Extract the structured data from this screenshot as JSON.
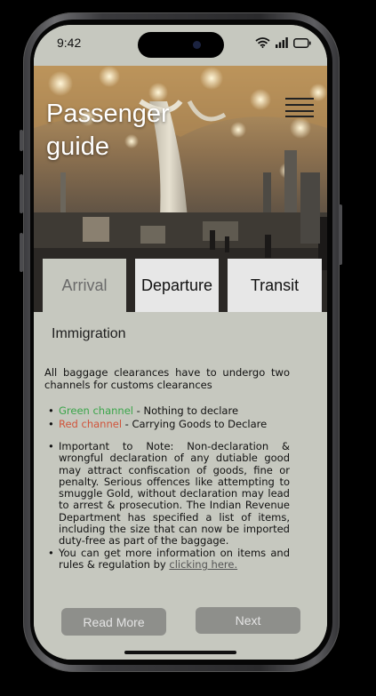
{
  "status_bar": {
    "time": "9:42"
  },
  "hero": {
    "title_line1": "Passenger",
    "title_line2": "guide"
  },
  "tabs": [
    {
      "label": "Arrival",
      "active": true
    },
    {
      "label": "Departure",
      "active": false
    },
    {
      "label": "Transit",
      "active": false
    }
  ],
  "section": {
    "title": "Immigration",
    "intro": "All baggage clearances have to undergo two channels for customs clearances",
    "channels": [
      {
        "name": "Green channel",
        "desc": " - Nothing to declare",
        "color": "#3aa54a"
      },
      {
        "name": "Red channel",
        "desc": " - Carrying Goods to Declare",
        "color": "#d0543b"
      }
    ],
    "note_1": "Important to Note: Non-declaration & wrongful declaration of any dutiable good may attract confiscation of goods, fine or penalty. Serious offences like attempting to smuggle Gold, without declaration may lead to arrest & prosecution. The Indian Revenue Department has specified a list of items, including the size that can now be imported duty-free as part of the baggage.",
    "note_2_prefix": "You can get more information on items and rules & regulation by ",
    "note_2_link": "clicking here."
  },
  "buttons": {
    "read_more": "Read More",
    "next": "Next"
  },
  "colors": {
    "screen_bg": "#c6c8bf",
    "tab_inactive_bg": "#e7e7e7",
    "button_bg": "#8e8f8b"
  }
}
